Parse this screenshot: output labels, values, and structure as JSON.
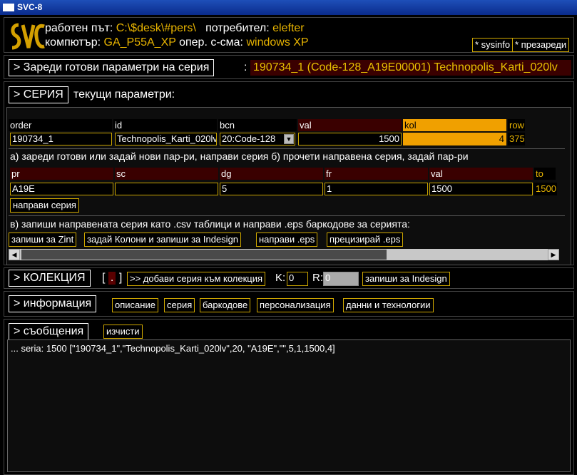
{
  "window": {
    "title": "SVC-8"
  },
  "header": {
    "logo": "SVC",
    "path_label": "работен път:",
    "path_value": "C:\\$desk\\#pers\\",
    "user_label": "потребител:",
    "user_value": "elefter",
    "computer_label": "компютър:",
    "computer_value": "GA_P55A_XP",
    "os_label": "опер. с-сма:",
    "os_value": "windows XP",
    "sysinfo_button": "* sysinfo",
    "reload_button": "* презареди"
  },
  "load_params": {
    "button": ">  Зареди готови параметри на серия",
    "separator": ":",
    "value": "190734_1 (Code-128_A19E00001) Technopolis_Karti_020lv"
  },
  "series": {
    "button": "> СЕРИЯ",
    "subtitle": "текущи параметри:",
    "row1": {
      "headers": [
        "order",
        "id",
        "bcn",
        "val",
        "kol",
        "row"
      ],
      "order": "190734_1",
      "id": "Technopolis_Karti_020lv",
      "bcn": "20:Code-128",
      "val": "1500",
      "kol": "4",
      "row": "375"
    },
    "instructions_a": "а) зареди готови или задай нови пар-ри, направи серия б) прочети направена серия, задай пар-ри",
    "row2": {
      "headers": [
        "pr",
        "sc",
        "dg",
        "fr",
        "val",
        "to"
      ],
      "pr": "A19E",
      "sc": "",
      "dg": "5",
      "fr": "1",
      "val": "1500",
      "to": "1500"
    },
    "make_series_button": "направи серия",
    "instructions_b": "в) запиши направената серия като .csv таблици и направи .eps баркодове за серията:",
    "save_zint_button": "запиши за Zint",
    "set_columns_button": "задай Колони и запиши за Indesign",
    "make_eps_button": "направи .eps",
    "refine_eps_button": "прецизирай .eps"
  },
  "collection": {
    "button": "> КОЛЕКЦИЯ",
    "bracket_open": "[",
    "marker": ".",
    "bracket_close": "]",
    "add_button": ">> добави серия към колекция",
    "k_label": "K:",
    "k_value": "0",
    "r_label": "R:",
    "r_value": "0",
    "save_indesign_button": "запиши за Indesign"
  },
  "info": {
    "button": "> информация",
    "tabs": [
      "описание",
      "серия",
      "баркодове",
      "персонализация",
      "данни и технологии"
    ]
  },
  "messages": {
    "button": "> съобщения",
    "clear_button": "изчисти",
    "log": "... seria: 1500 [\"190734_1\",\"Technopolis_Karti_020lv\",20, \"A19E\",\"\",5,1,1500,4]"
  },
  "colors": {
    "accent": "#e8b400",
    "dark_red": "#3a0000",
    "orange": "#f0a000"
  }
}
